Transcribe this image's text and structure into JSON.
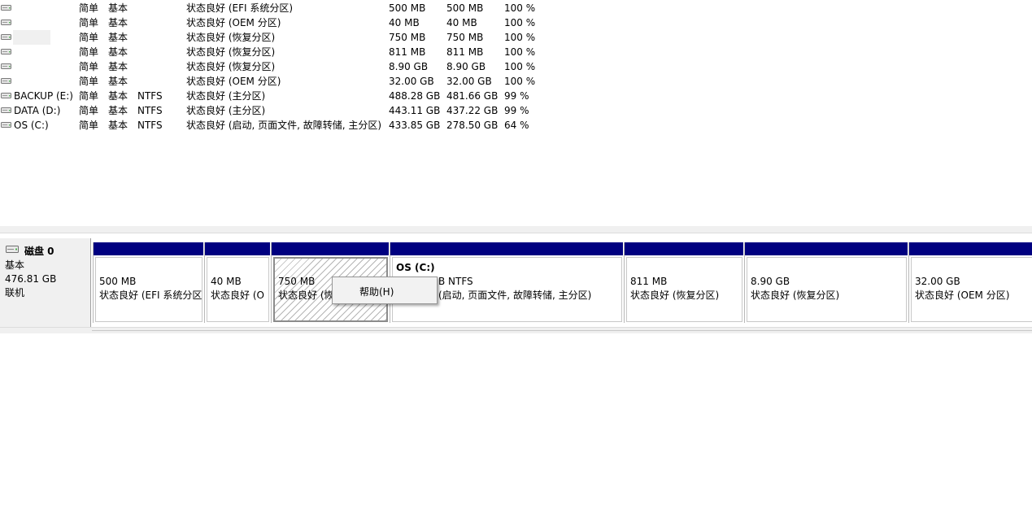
{
  "volumes": [
    {
      "name": "",
      "layout": "简单",
      "type": "基本",
      "fs": "",
      "status": "状态良好 (EFI 系统分区)",
      "capacity": "500 MB",
      "free": "500 MB",
      "pct_free": "100 %"
    },
    {
      "name": "",
      "layout": "简单",
      "type": "基本",
      "fs": "",
      "status": "状态良好 (OEM 分区)",
      "capacity": "40 MB",
      "free": "40 MB",
      "pct_free": "100 %"
    },
    {
      "name": "",
      "layout": "简单",
      "type": "基本",
      "fs": "",
      "status": "状态良好 (恢复分区)",
      "capacity": "750 MB",
      "free": "750 MB",
      "pct_free": "100 %"
    },
    {
      "name": "",
      "layout": "简单",
      "type": "基本",
      "fs": "",
      "status": "状态良好 (恢复分区)",
      "capacity": "811 MB",
      "free": "811 MB",
      "pct_free": "100 %"
    },
    {
      "name": "",
      "layout": "简单",
      "type": "基本",
      "fs": "",
      "status": "状态良好 (恢复分区)",
      "capacity": "8.90 GB",
      "free": "8.90 GB",
      "pct_free": "100 %"
    },
    {
      "name": "",
      "layout": "简单",
      "type": "基本",
      "fs": "",
      "status": "状态良好 (OEM 分区)",
      "capacity": "32.00 GB",
      "free": "32.00 GB",
      "pct_free": "100 %"
    },
    {
      "name": "BACKUP (E:)",
      "layout": "简单",
      "type": "基本",
      "fs": "NTFS",
      "status": "状态良好 (主分区)",
      "capacity": "488.28 GB",
      "free": "481.66 GB",
      "pct_free": "99 %"
    },
    {
      "name": "DATA (D:)",
      "layout": "简单",
      "type": "基本",
      "fs": "NTFS",
      "status": "状态良好 (主分区)",
      "capacity": "443.11 GB",
      "free": "437.22 GB",
      "pct_free": "99 %"
    },
    {
      "name": "OS (C:)",
      "layout": "简单",
      "type": "基本",
      "fs": "NTFS",
      "status": "状态良好 (启动, 页面文件, 故障转储, 主分区)",
      "capacity": "433.85 GB",
      "free": "278.50 GB",
      "pct_free": "64 %"
    }
  ],
  "disk": {
    "name": "磁盘 0",
    "type": "基本",
    "size": "476.81 GB",
    "state": "联机",
    "icon": "disk-drive-icon"
  },
  "partitions": [
    {
      "title": "",
      "line1": "500 MB",
      "line2": "状态良好 (EFI 系统分区",
      "selected": false
    },
    {
      "title": "",
      "line1": "40 MB",
      "line2": "状态良好 (O",
      "selected": false
    },
    {
      "title": "",
      "line1": "750 MB",
      "line2": "状态良好 (恢",
      "selected": true
    },
    {
      "title": "OS  (C:)",
      "line1": "B NTFS",
      "line2": "(启动, 页面文件, 故障转储, 主分区)",
      "selected": false
    },
    {
      "title": "",
      "line1": "811 MB",
      "line2": "状态良好 (恢复分区)",
      "selected": false
    },
    {
      "title": "",
      "line1": "8.90 GB",
      "line2": "状态良好 (恢复分区)",
      "selected": false
    },
    {
      "title": "",
      "line1": "32.00 GB",
      "line2": "状态良好 (OEM 分区)",
      "selected": false
    }
  ],
  "context_menu": {
    "items": [
      "帮助(H)"
    ]
  },
  "colors": {
    "partition_bar": "#000080",
    "background": "#ffffff",
    "panel": "#f0f0f0"
  }
}
